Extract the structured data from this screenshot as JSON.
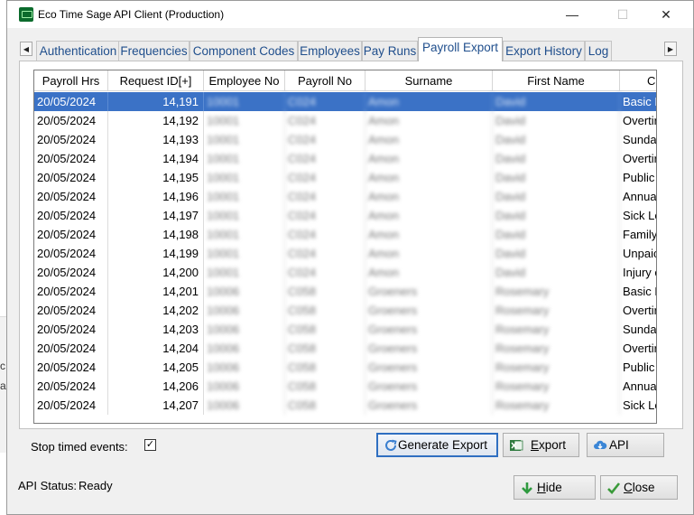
{
  "window": {
    "title": "Eco Time Sage API Client (Production)",
    "controls": {
      "minimize": "—",
      "maximize": "☐",
      "close": "✕"
    }
  },
  "tabs": [
    {
      "label": "Authentication",
      "active": false
    },
    {
      "label": "Frequencies",
      "active": false
    },
    {
      "label": "Component Codes",
      "active": false
    },
    {
      "label": "Employees",
      "active": false
    },
    {
      "label": "Pay Runs",
      "active": false
    },
    {
      "label": "Payroll Export",
      "active": true
    },
    {
      "label": "Export History",
      "active": false
    },
    {
      "label": "Log",
      "active": false
    }
  ],
  "tab_scroll": {
    "left": "◀",
    "right": "▶"
  },
  "grid": {
    "columns": [
      "Payroll Hrs",
      "Request ID[+]",
      "Employee No",
      "Payroll No",
      "Surname",
      "First Name",
      "C"
    ],
    "rows": [
      {
        "date": "20/05/2024",
        "request_id": "14,191",
        "employee_no": "10001",
        "payroll_no": "C024",
        "surname": "Amon",
        "first_name": "David",
        "component": "Basic P",
        "selected": true
      },
      {
        "date": "20/05/2024",
        "request_id": "14,192",
        "employee_no": "10001",
        "payroll_no": "C024",
        "surname": "Amon",
        "first_name": "David",
        "component": "Overtir",
        "selected": false
      },
      {
        "date": "20/05/2024",
        "request_id": "14,193",
        "employee_no": "10001",
        "payroll_no": "C024",
        "surname": "Amon",
        "first_name": "David",
        "component": "Sunday",
        "selected": false
      },
      {
        "date": "20/05/2024",
        "request_id": "14,194",
        "employee_no": "10001",
        "payroll_no": "C024",
        "surname": "Amon",
        "first_name": "David",
        "component": "Overtir",
        "selected": false
      },
      {
        "date": "20/05/2024",
        "request_id": "14,195",
        "employee_no": "10001",
        "payroll_no": "C024",
        "surname": "Amon",
        "first_name": "David",
        "component": "Public",
        "selected": false
      },
      {
        "date": "20/05/2024",
        "request_id": "14,196",
        "employee_no": "10001",
        "payroll_no": "C024",
        "surname": "Amon",
        "first_name": "David",
        "component": "Annual",
        "selected": false
      },
      {
        "date": "20/05/2024",
        "request_id": "14,197",
        "employee_no": "10001",
        "payroll_no": "C024",
        "surname": "Amon",
        "first_name": "David",
        "component": "Sick Le",
        "selected": false
      },
      {
        "date": "20/05/2024",
        "request_id": "14,198",
        "employee_no": "10001",
        "payroll_no": "C024",
        "surname": "Amon",
        "first_name": "David",
        "component": "Family",
        "selected": false
      },
      {
        "date": "20/05/2024",
        "request_id": "14,199",
        "employee_no": "10001",
        "payroll_no": "C024",
        "surname": "Amon",
        "first_name": "David",
        "component": "Unpaic",
        "selected": false
      },
      {
        "date": "20/05/2024",
        "request_id": "14,200",
        "employee_no": "10001",
        "payroll_no": "C024",
        "surname": "Amon",
        "first_name": "David",
        "component": "Injury c",
        "selected": false
      },
      {
        "date": "20/05/2024",
        "request_id": "14,201",
        "employee_no": "10006",
        "payroll_no": "C058",
        "surname": "Groeners",
        "first_name": "Rosemary",
        "component": "Basic P",
        "selected": false
      },
      {
        "date": "20/05/2024",
        "request_id": "14,202",
        "employee_no": "10006",
        "payroll_no": "C058",
        "surname": "Groeners",
        "first_name": "Rosemary",
        "component": "Overtir",
        "selected": false
      },
      {
        "date": "20/05/2024",
        "request_id": "14,203",
        "employee_no": "10006",
        "payroll_no": "C058",
        "surname": "Groeners",
        "first_name": "Rosemary",
        "component": "Sunday",
        "selected": false
      },
      {
        "date": "20/05/2024",
        "request_id": "14,204",
        "employee_no": "10006",
        "payroll_no": "C058",
        "surname": "Groeners",
        "first_name": "Rosemary",
        "component": "Overtir",
        "selected": false
      },
      {
        "date": "20/05/2024",
        "request_id": "14,205",
        "employee_no": "10006",
        "payroll_no": "C058",
        "surname": "Groeners",
        "first_name": "Rosemary",
        "component": "Public",
        "selected": false
      },
      {
        "date": "20/05/2024",
        "request_id": "14,206",
        "employee_no": "10006",
        "payroll_no": "C058",
        "surname": "Groeners",
        "first_name": "Rosemary",
        "component": "Annual",
        "selected": false
      },
      {
        "date": "20/05/2024",
        "request_id": "14,207",
        "employee_no": "10006",
        "payroll_no": "C058",
        "surname": "Groeners",
        "first_name": "Rosemary",
        "component": "Sick Le",
        "selected": false
      }
    ]
  },
  "options": {
    "stop_timed_events_label": "Stop timed events:",
    "stop_timed_events_checked": true,
    "check_glyph": "✓"
  },
  "buttons": {
    "generate_export": "Generate Export",
    "export": {
      "accel": "E",
      "rest": "xport"
    },
    "api": "API",
    "hide": {
      "accel": "H",
      "rest": "ide"
    },
    "close": {
      "accel": "C",
      "rest": "lose"
    }
  },
  "status": {
    "label": "API Status:",
    "value": "Ready"
  },
  "background_text": [
    "c",
    "ai"
  ],
  "colors": {
    "selection": "#3b72c6",
    "tab_text": "#1f4e8c",
    "default_button_border": "#2f6fc1"
  }
}
